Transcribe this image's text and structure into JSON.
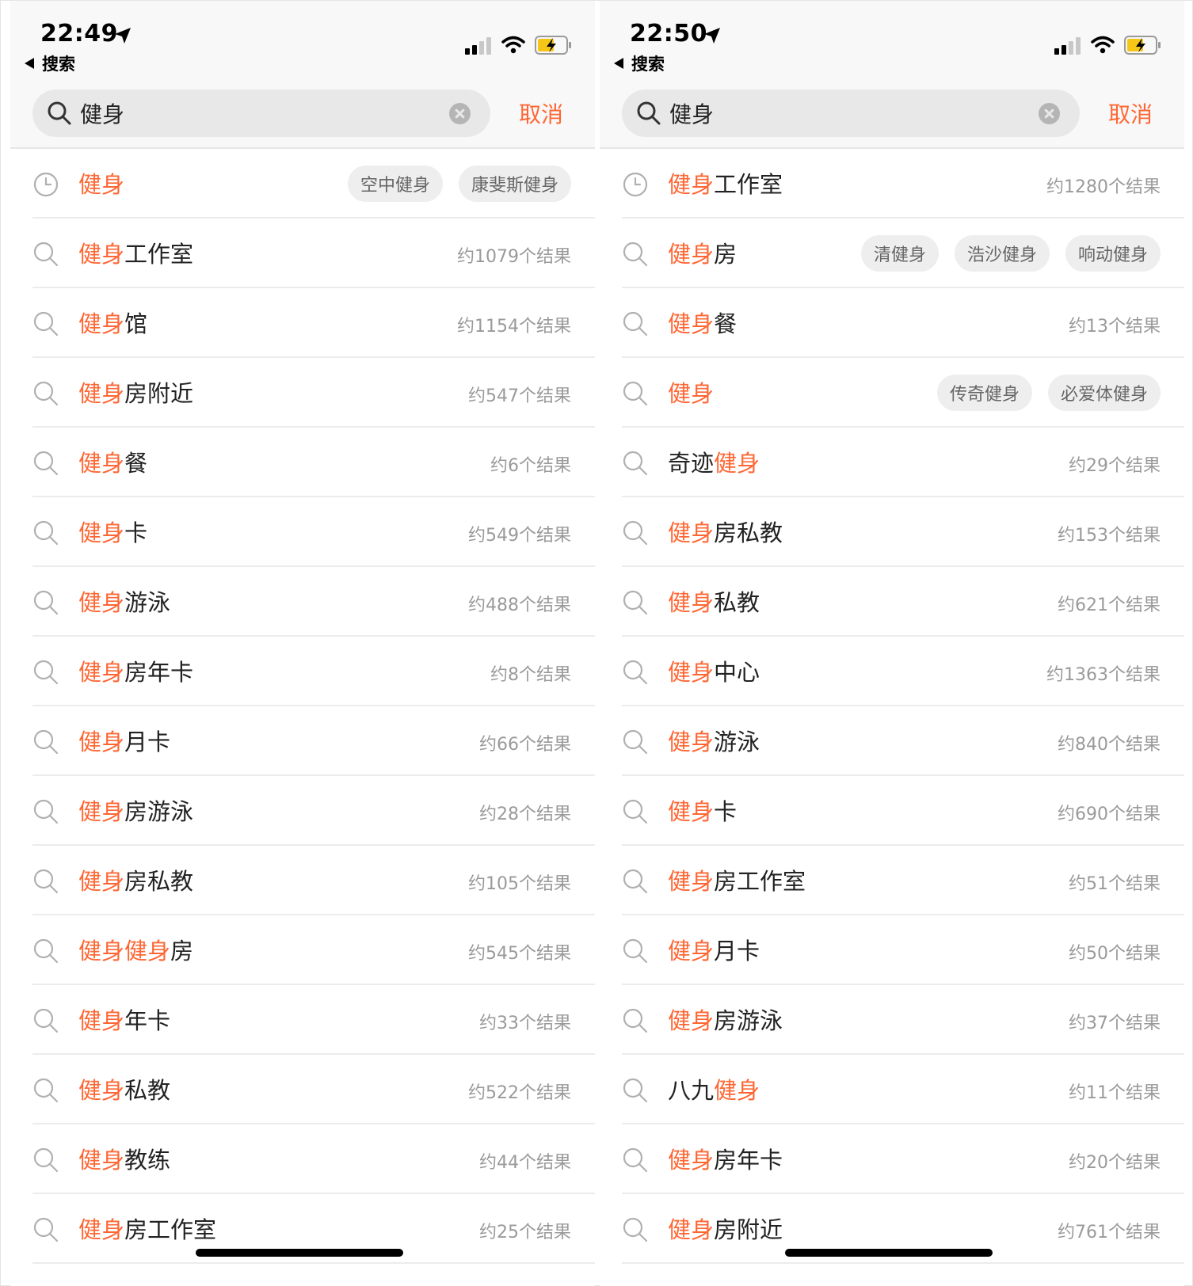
{
  "colors": {
    "accent": "#ff6633",
    "count_text": "#9a9a9a",
    "chip_bg": "#eeeeee"
  },
  "screens": [
    {
      "time": "22:49",
      "back_label": "搜索",
      "query": "健身",
      "cancel": "取消",
      "rows": [
        {
          "icon": "clock-icon",
          "parts": [
            {
              "t": "健身",
              "h": true
            }
          ],
          "count": "",
          "chips": [
            "空中健身",
            "康斐斯健身"
          ]
        },
        {
          "icon": "search-icon",
          "parts": [
            {
              "t": "健身",
              "h": true
            },
            {
              "t": "工作室",
              "h": false
            }
          ],
          "count": "约1079个结果",
          "chips": []
        },
        {
          "icon": "search-icon",
          "parts": [
            {
              "t": "健身",
              "h": true
            },
            {
              "t": "馆",
              "h": false
            }
          ],
          "count": "约1154个结果",
          "chips": []
        },
        {
          "icon": "search-icon",
          "parts": [
            {
              "t": "健身",
              "h": true
            },
            {
              "t": "房附近",
              "h": false
            }
          ],
          "count": "约547个结果",
          "chips": []
        },
        {
          "icon": "search-icon",
          "parts": [
            {
              "t": "健身",
              "h": true
            },
            {
              "t": "餐",
              "h": false
            }
          ],
          "count": "约6个结果",
          "chips": []
        },
        {
          "icon": "search-icon",
          "parts": [
            {
              "t": "健身",
              "h": true
            },
            {
              "t": "卡",
              "h": false
            }
          ],
          "count": "约549个结果",
          "chips": []
        },
        {
          "icon": "search-icon",
          "parts": [
            {
              "t": "健身",
              "h": true
            },
            {
              "t": "游泳",
              "h": false
            }
          ],
          "count": "约488个结果",
          "chips": []
        },
        {
          "icon": "search-icon",
          "parts": [
            {
              "t": "健身",
              "h": true
            },
            {
              "t": "房年卡",
              "h": false
            }
          ],
          "count": "约8个结果",
          "chips": []
        },
        {
          "icon": "search-icon",
          "parts": [
            {
              "t": "健身",
              "h": true
            },
            {
              "t": "月卡",
              "h": false
            }
          ],
          "count": "约66个结果",
          "chips": []
        },
        {
          "icon": "search-icon",
          "parts": [
            {
              "t": "健身",
              "h": true
            },
            {
              "t": "房游泳",
              "h": false
            }
          ],
          "count": "约28个结果",
          "chips": []
        },
        {
          "icon": "search-icon",
          "parts": [
            {
              "t": "健身",
              "h": true
            },
            {
              "t": "房私教",
              "h": false
            }
          ],
          "count": "约105个结果",
          "chips": []
        },
        {
          "icon": "search-icon",
          "parts": [
            {
              "t": "健身",
              "h": true
            },
            {
              "t": "健身",
              "h": true
            },
            {
              "t": "房",
              "h": false
            }
          ],
          "count": "约545个结果",
          "chips": []
        },
        {
          "icon": "search-icon",
          "parts": [
            {
              "t": "健身",
              "h": true
            },
            {
              "t": "年卡",
              "h": false
            }
          ],
          "count": "约33个结果",
          "chips": []
        },
        {
          "icon": "search-icon",
          "parts": [
            {
              "t": "健身",
              "h": true
            },
            {
              "t": "私教",
              "h": false
            }
          ],
          "count": "约522个结果",
          "chips": []
        },
        {
          "icon": "search-icon",
          "parts": [
            {
              "t": "健身",
              "h": true
            },
            {
              "t": "教练",
              "h": false
            }
          ],
          "count": "约44个结果",
          "chips": []
        },
        {
          "icon": "search-icon",
          "parts": [
            {
              "t": "健身",
              "h": true
            },
            {
              "t": "房工作室",
              "h": false
            }
          ],
          "count": "约25个结果",
          "chips": []
        }
      ]
    },
    {
      "time": "22:50",
      "back_label": "搜索",
      "query": "健身",
      "cancel": "取消",
      "rows": [
        {
          "icon": "clock-icon",
          "parts": [
            {
              "t": "健身",
              "h": true
            },
            {
              "t": "工作室",
              "h": false
            }
          ],
          "count": "约1280个结果",
          "chips": []
        },
        {
          "icon": "search-icon",
          "parts": [
            {
              "t": "健身",
              "h": true
            },
            {
              "t": "房",
              "h": false
            }
          ],
          "count": "",
          "chips": [
            "清健身",
            "浩沙健身",
            "响动健身"
          ]
        },
        {
          "icon": "search-icon",
          "parts": [
            {
              "t": "健身",
              "h": true
            },
            {
              "t": "餐",
              "h": false
            }
          ],
          "count": "约13个结果",
          "chips": []
        },
        {
          "icon": "search-icon",
          "parts": [
            {
              "t": "健身",
              "h": true
            }
          ],
          "count": "",
          "chips": [
            "传奇健身",
            "必爱体健身"
          ]
        },
        {
          "icon": "search-icon",
          "parts": [
            {
              "t": "奇迹",
              "h": false
            },
            {
              "t": "健身",
              "h": true
            }
          ],
          "count": "约29个结果",
          "chips": []
        },
        {
          "icon": "search-icon",
          "parts": [
            {
              "t": "健身",
              "h": true
            },
            {
              "t": "房私教",
              "h": false
            }
          ],
          "count": "约153个结果",
          "chips": []
        },
        {
          "icon": "search-icon",
          "parts": [
            {
              "t": "健身",
              "h": true
            },
            {
              "t": "私教",
              "h": false
            }
          ],
          "count": "约621个结果",
          "chips": []
        },
        {
          "icon": "search-icon",
          "parts": [
            {
              "t": "健身",
              "h": true
            },
            {
              "t": "中心",
              "h": false
            }
          ],
          "count": "约1363个结果",
          "chips": []
        },
        {
          "icon": "search-icon",
          "parts": [
            {
              "t": "健身",
              "h": true
            },
            {
              "t": "游泳",
              "h": false
            }
          ],
          "count": "约840个结果",
          "chips": []
        },
        {
          "icon": "search-icon",
          "parts": [
            {
              "t": "健身",
              "h": true
            },
            {
              "t": "卡",
              "h": false
            }
          ],
          "count": "约690个结果",
          "chips": []
        },
        {
          "icon": "search-icon",
          "parts": [
            {
              "t": "健身",
              "h": true
            },
            {
              "t": "房工作室",
              "h": false
            }
          ],
          "count": "约51个结果",
          "chips": []
        },
        {
          "icon": "search-icon",
          "parts": [
            {
              "t": "健身",
              "h": true
            },
            {
              "t": "月卡",
              "h": false
            }
          ],
          "count": "约50个结果",
          "chips": []
        },
        {
          "icon": "search-icon",
          "parts": [
            {
              "t": "健身",
              "h": true
            },
            {
              "t": "房游泳",
              "h": false
            }
          ],
          "count": "约37个结果",
          "chips": []
        },
        {
          "icon": "search-icon",
          "parts": [
            {
              "t": "八九",
              "h": false
            },
            {
              "t": "健身",
              "h": true
            }
          ],
          "count": "约11个结果",
          "chips": []
        },
        {
          "icon": "search-icon",
          "parts": [
            {
              "t": "健身",
              "h": true
            },
            {
              "t": "房年卡",
              "h": false
            }
          ],
          "count": "约20个结果",
          "chips": []
        },
        {
          "icon": "search-icon",
          "parts": [
            {
              "t": "健身",
              "h": true
            },
            {
              "t": "房附近",
              "h": false
            }
          ],
          "count": "约761个结果",
          "chips": []
        }
      ]
    }
  ]
}
